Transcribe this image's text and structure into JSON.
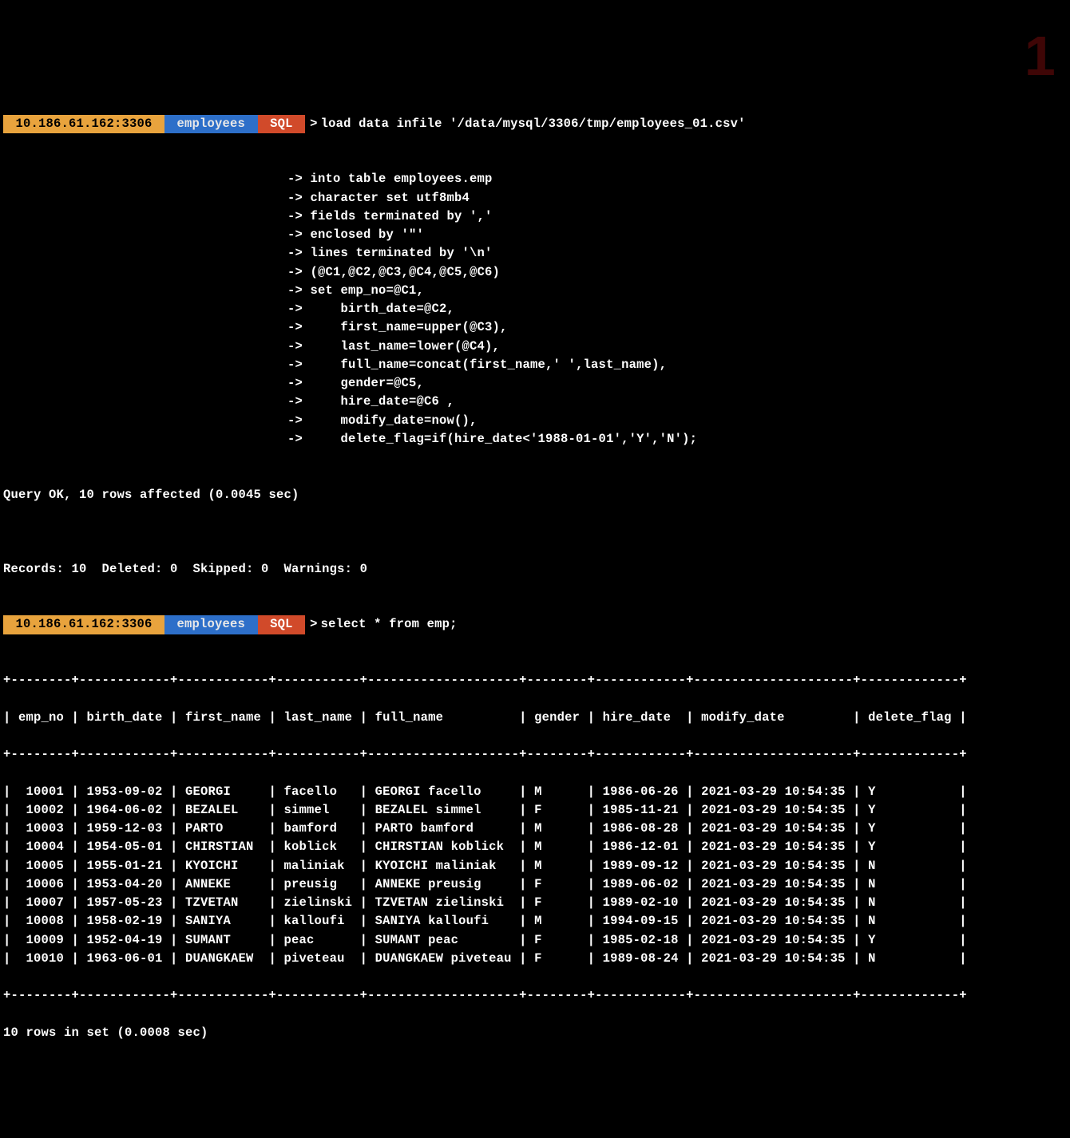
{
  "watermark": "1",
  "prompt": {
    "host": " 10.186.61.162:3306 ",
    "db": " employees ",
    "sql": " SQL ",
    "sep": ">"
  },
  "cmd1": {
    "first": "load data infile '/data/mysql/3306/tmp/employees_01.csv'",
    "lines": [
      "-> into table employees.emp",
      "-> character set utf8mb4",
      "-> fields terminated by ','",
      "-> enclosed by '\"'",
      "-> lines terminated by '\\n'",
      "-> (@C1,@C2,@C3,@C4,@C5,@C6)",
      "-> set emp_no=@C1,",
      "->     birth_date=@C2,",
      "->     first_name=upper(@C3),",
      "->     last_name=lower(@C4),",
      "->     full_name=concat(first_name,' ',last_name),",
      "->     gender=@C5,",
      "->     hire_date=@C6 ,",
      "->     modify_date=now(),",
      "->     delete_flag=if(hire_date<'1988-01-01','Y','N');"
    ]
  },
  "result1": "Query OK, 10 rows affected (0.0045 sec)",
  "blank": " ",
  "records_line": "Records: 10  Deleted: 0  Skipped: 0  Warnings: 0",
  "cmd2": "select * from emp;",
  "table": {
    "border": "+--------+------------+------------+-----------+--------------------+--------+------------+---------------------+-------------+",
    "header": "| emp_no | birth_date | first_name | last_name | full_name          | gender | hire_date  | modify_date         | delete_flag |",
    "rows": [
      "|  10001 | 1953-09-02 | GEORGI     | facello   | GEORGI facello     | M      | 1986-06-26 | 2021-03-29 10:54:35 | Y           |",
      "|  10002 | 1964-06-02 | BEZALEL    | simmel    | BEZALEL simmel     | F      | 1985-11-21 | 2021-03-29 10:54:35 | Y           |",
      "|  10003 | 1959-12-03 | PARTO      | bamford   | PARTO bamford      | M      | 1986-08-28 | 2021-03-29 10:54:35 | Y           |",
      "|  10004 | 1954-05-01 | CHIRSTIAN  | koblick   | CHIRSTIAN koblick  | M      | 1986-12-01 | 2021-03-29 10:54:35 | Y           |",
      "|  10005 | 1955-01-21 | KYOICHI    | maliniak  | KYOICHI maliniak   | M      | 1989-09-12 | 2021-03-29 10:54:35 | N           |",
      "|  10006 | 1953-04-20 | ANNEKE     | preusig   | ANNEKE preusig     | F      | 1989-06-02 | 2021-03-29 10:54:35 | N           |",
      "|  10007 | 1957-05-23 | TZVETAN    | zielinski | TZVETAN zielinski  | F      | 1989-02-10 | 2021-03-29 10:54:35 | N           |",
      "|  10008 | 1958-02-19 | SANIYA     | kalloufi  | SANIYA kalloufi    | M      | 1994-09-15 | 2021-03-29 10:54:35 | N           |",
      "|  10009 | 1952-04-19 | SUMANT     | peac      | SUMANT peac        | F      | 1985-02-18 | 2021-03-29 10:54:35 | Y           |",
      "|  10010 | 1963-06-01 | DUANGKAEW  | piveteau  | DUANGKAEW piveteau | F      | 1989-08-24 | 2021-03-29 10:54:35 | N           |"
    ]
  },
  "result2": "10 rows in set (0.0008 sec)",
  "chart_data": {
    "type": "table",
    "title": "emp",
    "columns": [
      "emp_no",
      "birth_date",
      "first_name",
      "last_name",
      "full_name",
      "gender",
      "hire_date",
      "modify_date",
      "delete_flag"
    ],
    "rows": [
      [
        10001,
        "1953-09-02",
        "GEORGI",
        "facello",
        "GEORGI facello",
        "M",
        "1986-06-26",
        "2021-03-29 10:54:35",
        "Y"
      ],
      [
        10002,
        "1964-06-02",
        "BEZALEL",
        "simmel",
        "BEZALEL simmel",
        "F",
        "1985-11-21",
        "2021-03-29 10:54:35",
        "Y"
      ],
      [
        10003,
        "1959-12-03",
        "PARTO",
        "bamford",
        "PARTO bamford",
        "M",
        "1986-08-28",
        "2021-03-29 10:54:35",
        "Y"
      ],
      [
        10004,
        "1954-05-01",
        "CHIRSTIAN",
        "koblick",
        "CHIRSTIAN koblick",
        "M",
        "1986-12-01",
        "2021-03-29 10:54:35",
        "Y"
      ],
      [
        10005,
        "1955-01-21",
        "KYOICHI",
        "maliniak",
        "KYOICHI maliniak",
        "M",
        "1989-09-12",
        "2021-03-29 10:54:35",
        "N"
      ],
      [
        10006,
        "1953-04-20",
        "ANNEKE",
        "preusig",
        "ANNEKE preusig",
        "F",
        "1989-06-02",
        "2021-03-29 10:54:35",
        "N"
      ],
      [
        10007,
        "1957-05-23",
        "TZVETAN",
        "zielinski",
        "TZVETAN zielinski",
        "F",
        "1989-02-10",
        "2021-03-29 10:54:35",
        "N"
      ],
      [
        10008,
        "1958-02-19",
        "SANIYA",
        "kalloufi",
        "SANIYA kalloufi",
        "M",
        "1994-09-15",
        "2021-03-29 10:54:35",
        "N"
      ],
      [
        10009,
        "1952-04-19",
        "SUMANT",
        "peac",
        "SUMANT peac",
        "F",
        "1985-02-18",
        "2021-03-29 10:54:35",
        "Y"
      ],
      [
        10010,
        "1963-06-01",
        "DUANGKAEW",
        "piveteau",
        "DUANGKAEW piveteau",
        "F",
        "1989-08-24",
        "2021-03-29 10:54:35",
        "N"
      ]
    ]
  }
}
